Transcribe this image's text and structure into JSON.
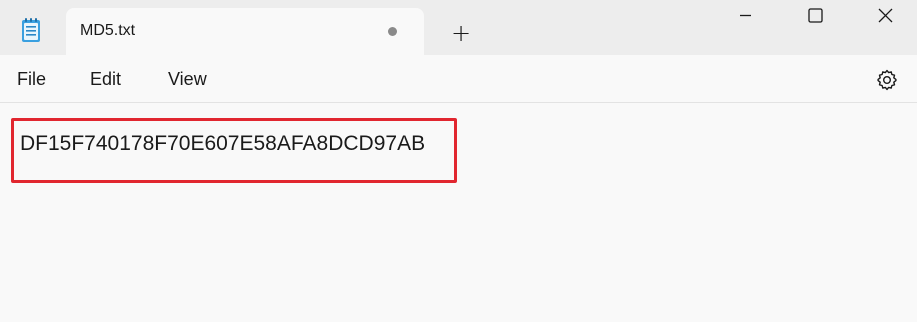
{
  "window": {
    "tab_title": "MD5.txt",
    "unsaved_indicator": "dot",
    "new_tab_symbol": "+",
    "controls": [
      "minimize-icon",
      "maximize-icon",
      "close-icon"
    ],
    "app_icon": "notepad-icon"
  },
  "menu": {
    "file": "File",
    "edit": "Edit",
    "view": "View",
    "settings_icon": "gear-icon"
  },
  "editor": {
    "content": "DF15F740178F70E607E58AFA8DCD97AB",
    "highlight_color": "#e1262f"
  }
}
